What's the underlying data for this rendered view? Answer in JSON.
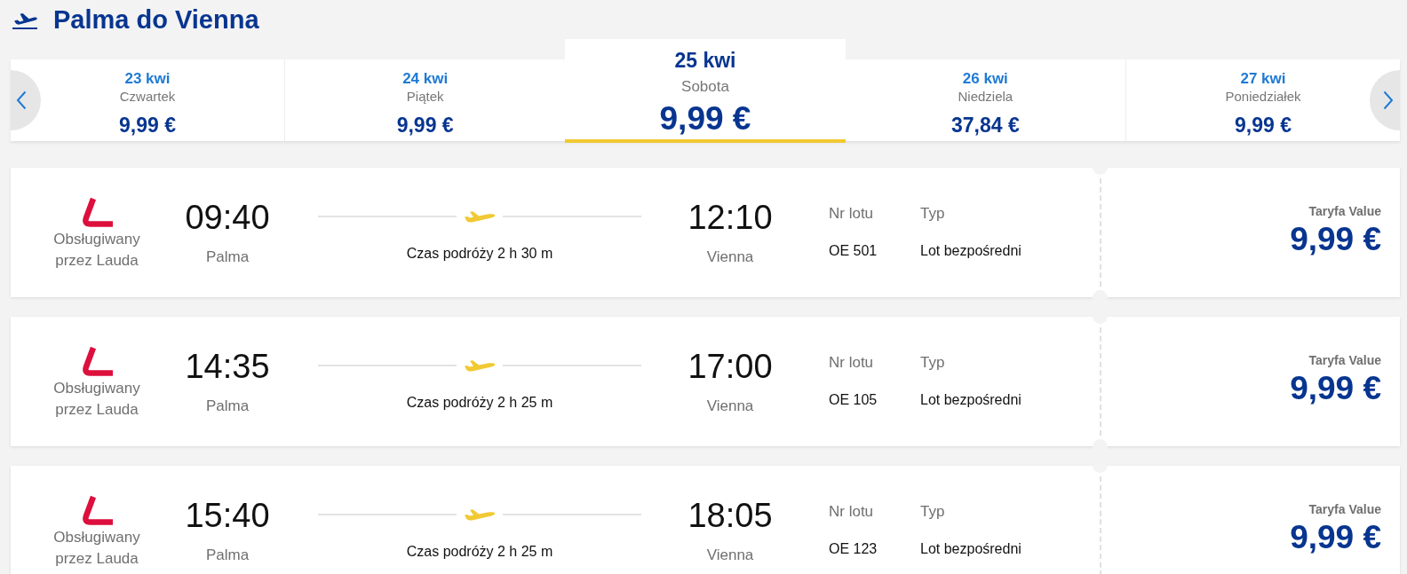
{
  "header": {
    "title": "Palma do Vienna"
  },
  "date_carousel": {
    "days": [
      {
        "date": "23 kwi",
        "weekday": "Czwartek",
        "price": "9,99 €",
        "selected": false
      },
      {
        "date": "24 kwi",
        "weekday": "Piątek",
        "price": "9,99 €",
        "selected": false
      },
      {
        "date": "25 kwi",
        "weekday": "Sobota",
        "price": "9,99 €",
        "selected": true
      },
      {
        "date": "26 kwi",
        "weekday": "Niedziela",
        "price": "37,84 €",
        "selected": false
      },
      {
        "date": "27 kwi",
        "weekday": "Poniedziałek",
        "price": "9,99 €",
        "selected": false
      }
    ]
  },
  "flights": [
    {
      "operator": "Obsługiwany przez Lauda",
      "departure": {
        "time": "09:40",
        "city": "Palma"
      },
      "duration": "Czas podróży 2 h 30 m",
      "arrival": {
        "time": "12:10",
        "city": "Vienna"
      },
      "flight_number_label": "Nr lotu",
      "flight_number": "OE 501",
      "type_label": "Typ",
      "type": "Lot bezpośredni",
      "fare_label": "Taryfa Value",
      "price": "9,99 €"
    },
    {
      "operator": "Obsługiwany przez Lauda",
      "departure": {
        "time": "14:35",
        "city": "Palma"
      },
      "duration": "Czas podróży 2 h 25 m",
      "arrival": {
        "time": "17:00",
        "city": "Vienna"
      },
      "flight_number_label": "Nr lotu",
      "flight_number": "OE 105",
      "type_label": "Typ",
      "type": "Lot bezpośredni",
      "fare_label": "Taryfa Value",
      "price": "9,99 €"
    },
    {
      "operator": "Obsługiwany przez Lauda",
      "departure": {
        "time": "15:40",
        "city": "Palma"
      },
      "duration": "Czas podróży 2 h 25 m",
      "arrival": {
        "time": "18:05",
        "city": "Vienna"
      },
      "flight_number_label": "Nr lotu",
      "flight_number": "OE 123",
      "type_label": "Typ",
      "type": "Lot bezpośredni",
      "fare_label": "Taryfa Value",
      "price": "9,99 €"
    }
  ]
}
